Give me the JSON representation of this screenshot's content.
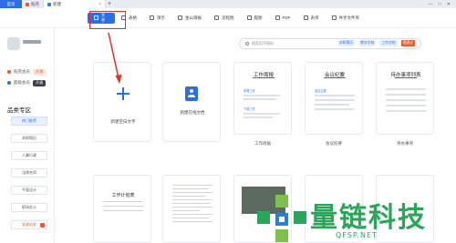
{
  "tabs": {
    "home": "首页",
    "items": [
      {
        "label": "稻壳",
        "icon": "docer-icon"
      },
      {
        "label": "新建",
        "icon": "docs-icon"
      }
    ],
    "add": "+"
  },
  "window": {
    "minimize": "—",
    "maximize": "□",
    "close": "✕"
  },
  "toolbar": {
    "home": "我的",
    "items": [
      "文字",
      "表格",
      "演示",
      "金山海报",
      "流程图",
      "脑图",
      "PDF",
      "表单",
      "共享文件夹"
    ]
  },
  "sidebar": {
    "members": [
      {
        "label": "稻壳会员",
        "badge": "开通"
      },
      {
        "label": "超级会员",
        "badge": "开通"
      }
    ],
    "section_title": "品类专区",
    "items": [
      "热门推荐",
      "求职简历",
      "人事行政",
      "法律合同",
      "平面设计",
      "职场办公",
      "党政机关"
    ]
  },
  "search": {
    "placeholder": "搜索稻壳模板",
    "links": [
      "求职简历",
      "教学总结",
      "工作总结",
      "提建议"
    ]
  },
  "cards": {
    "new_blank": "新建空白文字",
    "new_online": "新建在线文档",
    "templates": [
      {
        "title": "工作周报",
        "label": "工作周报",
        "lines": [
          "本周工作",
          "下周工作"
        ]
      },
      {
        "title": "会议纪要",
        "label": "会议纪要",
        "lines": [
          "会议主题"
        ]
      },
      {
        "title": "待办事项列表",
        "label": "待办事项",
        "lines": []
      }
    ],
    "row2": [
      {
        "title": "工作计划表"
      }
    ]
  },
  "watermark": {
    "text": "量链科技",
    "url": "QFSP.NET"
  },
  "colors": {
    "accent": "#2b6fe8",
    "highlight": "#e0302a",
    "brand_green": "#2aa55a"
  }
}
